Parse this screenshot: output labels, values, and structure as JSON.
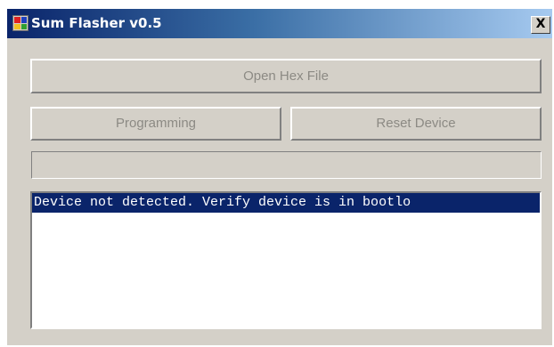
{
  "window": {
    "title": "Sum Flasher v0.5",
    "close_glyph": "X",
    "icon": "app-icon"
  },
  "buttons": {
    "open_hex": "Open Hex File",
    "programming": "Programming",
    "reset_device": "Reset Device"
  },
  "progress": {
    "value": 0
  },
  "log": {
    "lines": [
      {
        "text": "Device not detected. Verify device is in bootlo",
        "selected": true
      }
    ]
  },
  "colors": {
    "titlebar_start": "#0a246a",
    "titlebar_end": "#a6caf0",
    "face": "#d4d0c8",
    "disabled_text": "#8c8a84",
    "selection": "#0a246a"
  }
}
